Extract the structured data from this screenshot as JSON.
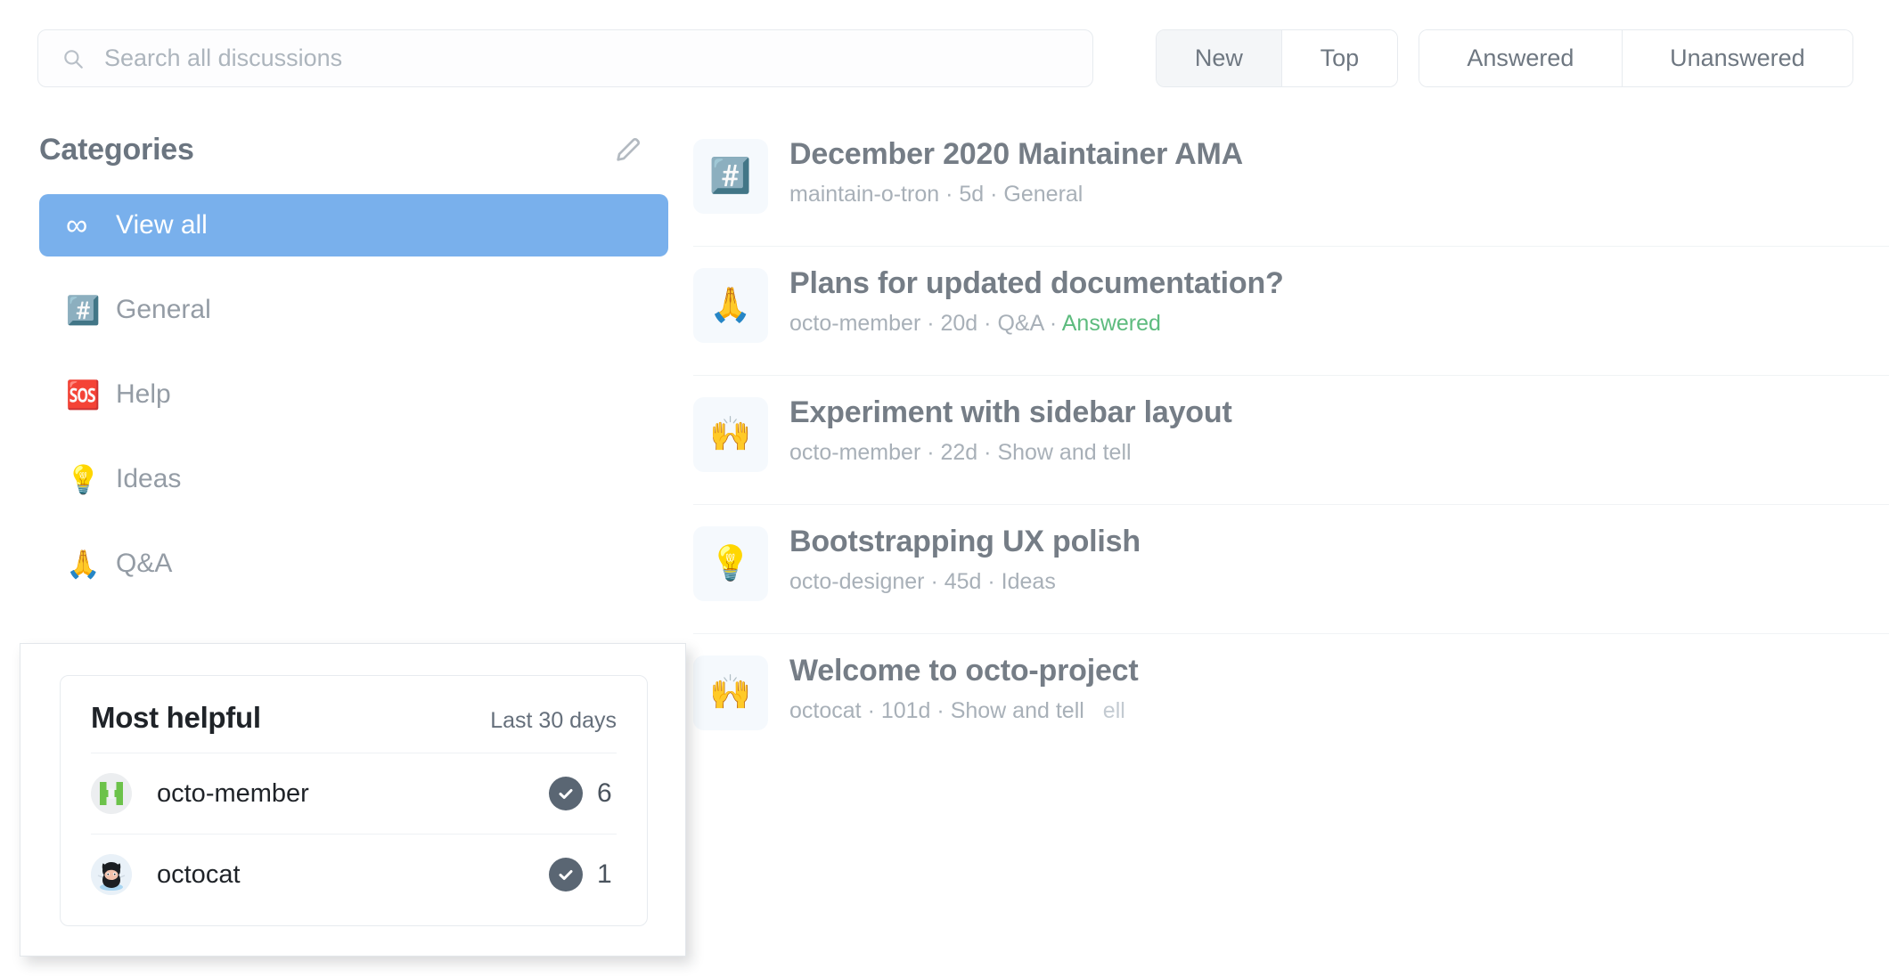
{
  "search": {
    "placeholder": "Search all discussions",
    "value": "",
    "icon": "search-icon"
  },
  "filters": {
    "sort": [
      {
        "label": "New",
        "selected": true
      },
      {
        "label": "Top",
        "selected": false
      }
    ],
    "answer": [
      {
        "label": "Answered",
        "selected": false
      },
      {
        "label": "Unanswered",
        "selected": false
      }
    ]
  },
  "sidebar": {
    "title": "Categories",
    "edit_icon": "pencil-icon",
    "items": [
      {
        "label": "View all",
        "emoji": "∞",
        "icon_name": "infinity-icon",
        "active": true
      },
      {
        "label": "General",
        "emoji": "#️⃣",
        "icon_name": "hash-emoji",
        "active": false
      },
      {
        "label": "Help",
        "emoji": "🆘",
        "icon_name": "sos-emoji",
        "active": false
      },
      {
        "label": "Ideas",
        "emoji": "💡",
        "icon_name": "lightbulb-emoji",
        "active": false
      },
      {
        "label": "Q&A",
        "emoji": "🙏",
        "icon_name": "folded-hands-emoji",
        "active": false
      }
    ]
  },
  "discussions": [
    {
      "emoji": "#️⃣",
      "icon_name": "hash-emoji",
      "title": "December 2020 Maintainer AMA",
      "author": "maintain-o-tron",
      "age": "5d",
      "category": "General",
      "status": "",
      "ghost": ""
    },
    {
      "emoji": "🙏",
      "icon_name": "folded-hands-emoji",
      "title": "Plans for updated documentation?",
      "author": "octo-member",
      "age": "20d",
      "category": "Q&A",
      "status": "Answered",
      "ghost": ""
    },
    {
      "emoji": "🙌",
      "icon_name": "raising-hands-emoji",
      "title": "Experiment with sidebar layout",
      "author": "octo-member",
      "age": "22d",
      "category": "Show and tell",
      "status": "",
      "ghost": ""
    },
    {
      "emoji": "💡",
      "icon_name": "lightbulb-emoji",
      "title": "Bootstrapping UX polish",
      "author": "octo-designer",
      "age": "45d",
      "category": "Ideas",
      "status": "",
      "ghost": ""
    },
    {
      "emoji": "🙌",
      "icon_name": "raising-hands-emoji",
      "title": "Welcome to octo-project",
      "author": "octocat",
      "age": "101d",
      "category": "Show and tell",
      "status": "",
      "ghost": "ell"
    }
  ],
  "most_helpful": {
    "title": "Most helpful",
    "range": "Last 30 days",
    "rows": [
      {
        "name": "octo-member",
        "avatar": "green-h-logo-avatar",
        "count": "6",
        "badge": "check-circle-icon"
      },
      {
        "name": "octocat",
        "avatar": "octocat-avatar",
        "count": "1",
        "badge": "check-circle-icon"
      }
    ]
  },
  "colors": {
    "accent_blue": "#79b0ec",
    "answered_green": "#5dbb7e",
    "badge_gray": "#5a6673",
    "tile_bg": "#f5f9fd"
  }
}
